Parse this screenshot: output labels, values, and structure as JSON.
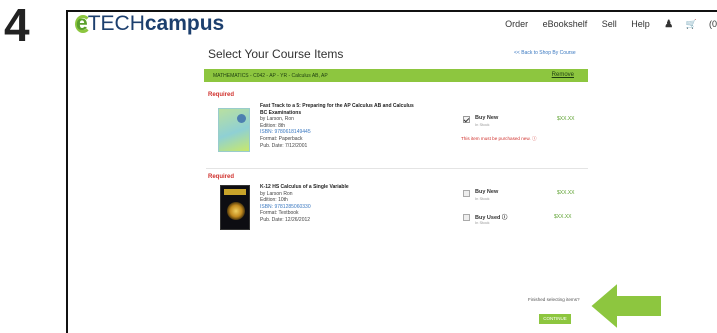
{
  "step_number": "4",
  "header": {
    "logo_prefix": "e",
    "logo_tech": "TECH",
    "logo_campus": "campus",
    "nav": [
      "Order",
      "eBookshelf",
      "Sell",
      "Help"
    ],
    "user_icon": "user-icon",
    "cart_icon": "cart-icon",
    "cart_label": "(0"
  },
  "page": {
    "title": "Select Your Course Items",
    "back_link": "<< Back to Shop By Course"
  },
  "course": {
    "name": "MATHEMATICS - C042 - AP - YR - Calculus AB, AP",
    "remove": "Remove"
  },
  "books": [
    {
      "required": "Required",
      "title_line1": "Fast Track to a 5: Preparing for the AP Calculus AB and Calculus",
      "title_line2": "BC Examinations",
      "author": "by Larson, Ron",
      "edition": "Edition: 8th",
      "isbn": "ISBN: 9780618149445",
      "format": "Format: Paperback",
      "pub_date": "Pub. Date: 7/12/2001",
      "options": [
        {
          "label": "Buy New",
          "stock": "In Stock",
          "price": "$XX.XX",
          "checked": true
        }
      ],
      "note": "This item must be purchased new."
    },
    {
      "required": "Required",
      "title_line1": "K-12 HS Calculus of a Single Variable",
      "author": "by Larson Ron",
      "edition": "Edition: 10th",
      "isbn": "ISBN: 9781285060330",
      "format": "Format: Textbook",
      "pub_date": "Pub. Date: 12/26/2012",
      "options": [
        {
          "label": "Buy New",
          "stock": "In Stock",
          "price": "$XX.XX",
          "checked": false
        },
        {
          "label": "Buy Used",
          "stock": "In Stock",
          "price": "$XX.XX",
          "checked": false
        }
      ]
    }
  ],
  "footer": {
    "finished_text": "Finished selecting items?",
    "continue_label": "CONTINUE"
  },
  "colors": {
    "accent_green": "#8dc63f",
    "price_green": "#5aa02c",
    "required_red": "#d0312d",
    "link_blue": "#3a78c0"
  }
}
